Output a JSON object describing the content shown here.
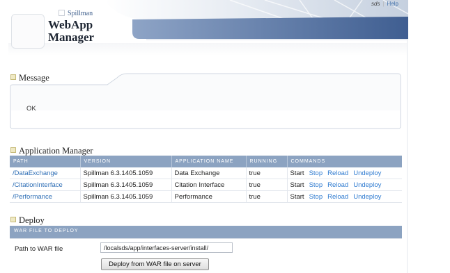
{
  "header": {
    "brand_small": "Spillman",
    "brand_line1": "WebApp",
    "brand_line2": "Manager",
    "user": "sds",
    "separator": "|",
    "help": "Help"
  },
  "message": {
    "title": "Message",
    "text": "OK"
  },
  "app_manager": {
    "title": "Application Manager",
    "columns": [
      "PATH",
      "VERSION",
      "APPLICATION NAME",
      "RUNNING",
      "COMMANDS"
    ],
    "rows": [
      {
        "path": "/DataExchange",
        "version": "Spillman 6.3.1405.1059",
        "name": "Data Exchange",
        "running": "true",
        "cmd_start": "Start",
        "cmd_stop": "Stop",
        "cmd_reload": "Reload",
        "cmd_undeploy": "Undeploy"
      },
      {
        "path": "/CitationInterface",
        "version": "Spillman 6.3.1405.1059",
        "name": "Citation Interface",
        "running": "true",
        "cmd_start": "Start",
        "cmd_stop": "Stop",
        "cmd_reload": "Reload",
        "cmd_undeploy": "Undeploy"
      },
      {
        "path": "/Performance",
        "version": "Spillman 6.3.1405.1059",
        "name": "Performance",
        "running": "true",
        "cmd_start": "Start",
        "cmd_stop": "Stop",
        "cmd_reload": "Reload",
        "cmd_undeploy": "Undeploy"
      }
    ]
  },
  "deploy": {
    "title": "Deploy",
    "bar_label": "WAR FILE TO DEPLOY",
    "path_label": "Path to WAR file",
    "path_value": "/localsds/app/interfaces-server/install/",
    "button_label": "Deploy from WAR file on server"
  },
  "colors": {
    "accent_bar": "#8ca3c1",
    "link": "#2f7bd0",
    "banner_dark": "#5b78a6"
  }
}
